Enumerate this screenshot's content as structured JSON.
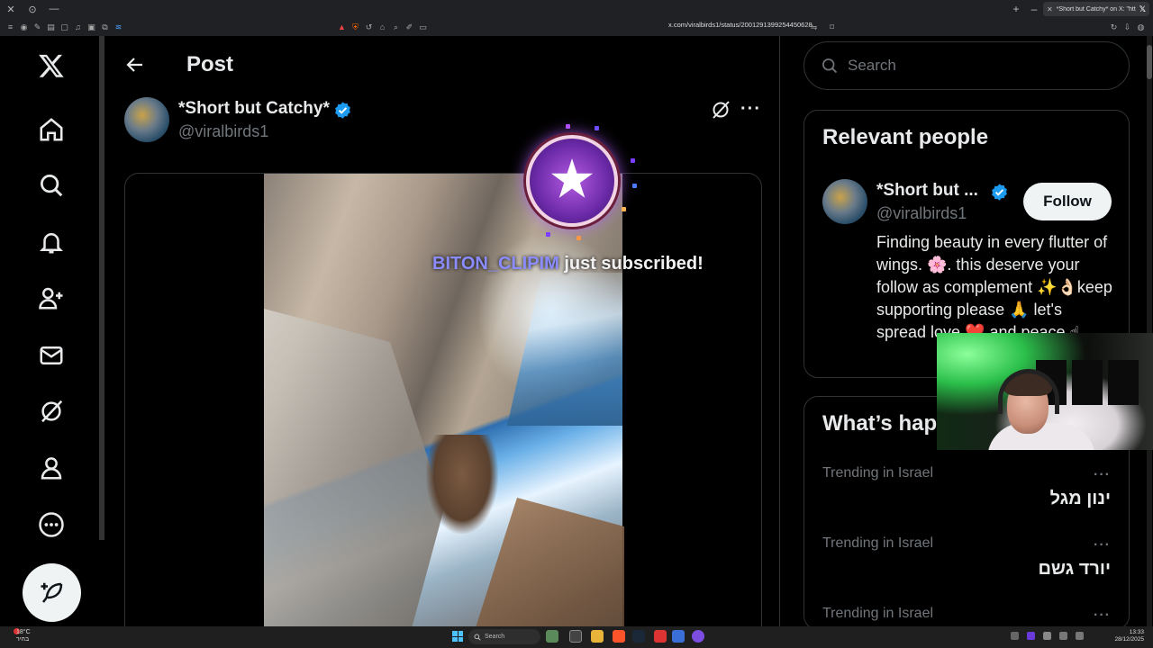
{
  "browser": {
    "tab_title": "*Short but Catchy* on X: \"https:",
    "url": "x.com/viralbirds1/status/2001291399254450628"
  },
  "nav": {
    "items": [
      "x-logo",
      "home",
      "explore",
      "notifications",
      "follow",
      "messages",
      "grok",
      "profile",
      "more"
    ],
    "post_button": "post"
  },
  "main": {
    "title": "Post",
    "author_name": "*Short but Catchy*",
    "author_handle": "@viralbirds1"
  },
  "overlay": {
    "subscriber": "BITON_CLIPIM",
    "message": " just subscribed!"
  },
  "search": {
    "placeholder": "Search"
  },
  "relevant_people": {
    "title": "Relevant people",
    "name": "*Short but ...",
    "handle": "@viralbirds1",
    "follow_label": "Follow",
    "bio": "Finding beauty in every flutter of wings. 🌸. this deserve your follow as complement ✨👌🏻keep supporting please 🙏 let's spread love ❤️ and peace ☝"
  },
  "whats_happening": {
    "title": "What’s happening",
    "trends": [
      {
        "category": "Trending in Israel",
        "name": "ינון מגל"
      },
      {
        "category": "Trending in Israel",
        "name": "יורד גשם"
      },
      {
        "category": "Trending in Israel",
        "name": ""
      }
    ]
  },
  "taskbar": {
    "temperature": "18°C",
    "weather_desc": "בהיר",
    "search_label": "Search",
    "time": "13:33",
    "date": "28/12/2025"
  },
  "colors": {
    "background": "#000000",
    "verified_blue": "#1d9bf0",
    "subscriber_name": "#8a8cff",
    "muted_text": "#71767b"
  }
}
